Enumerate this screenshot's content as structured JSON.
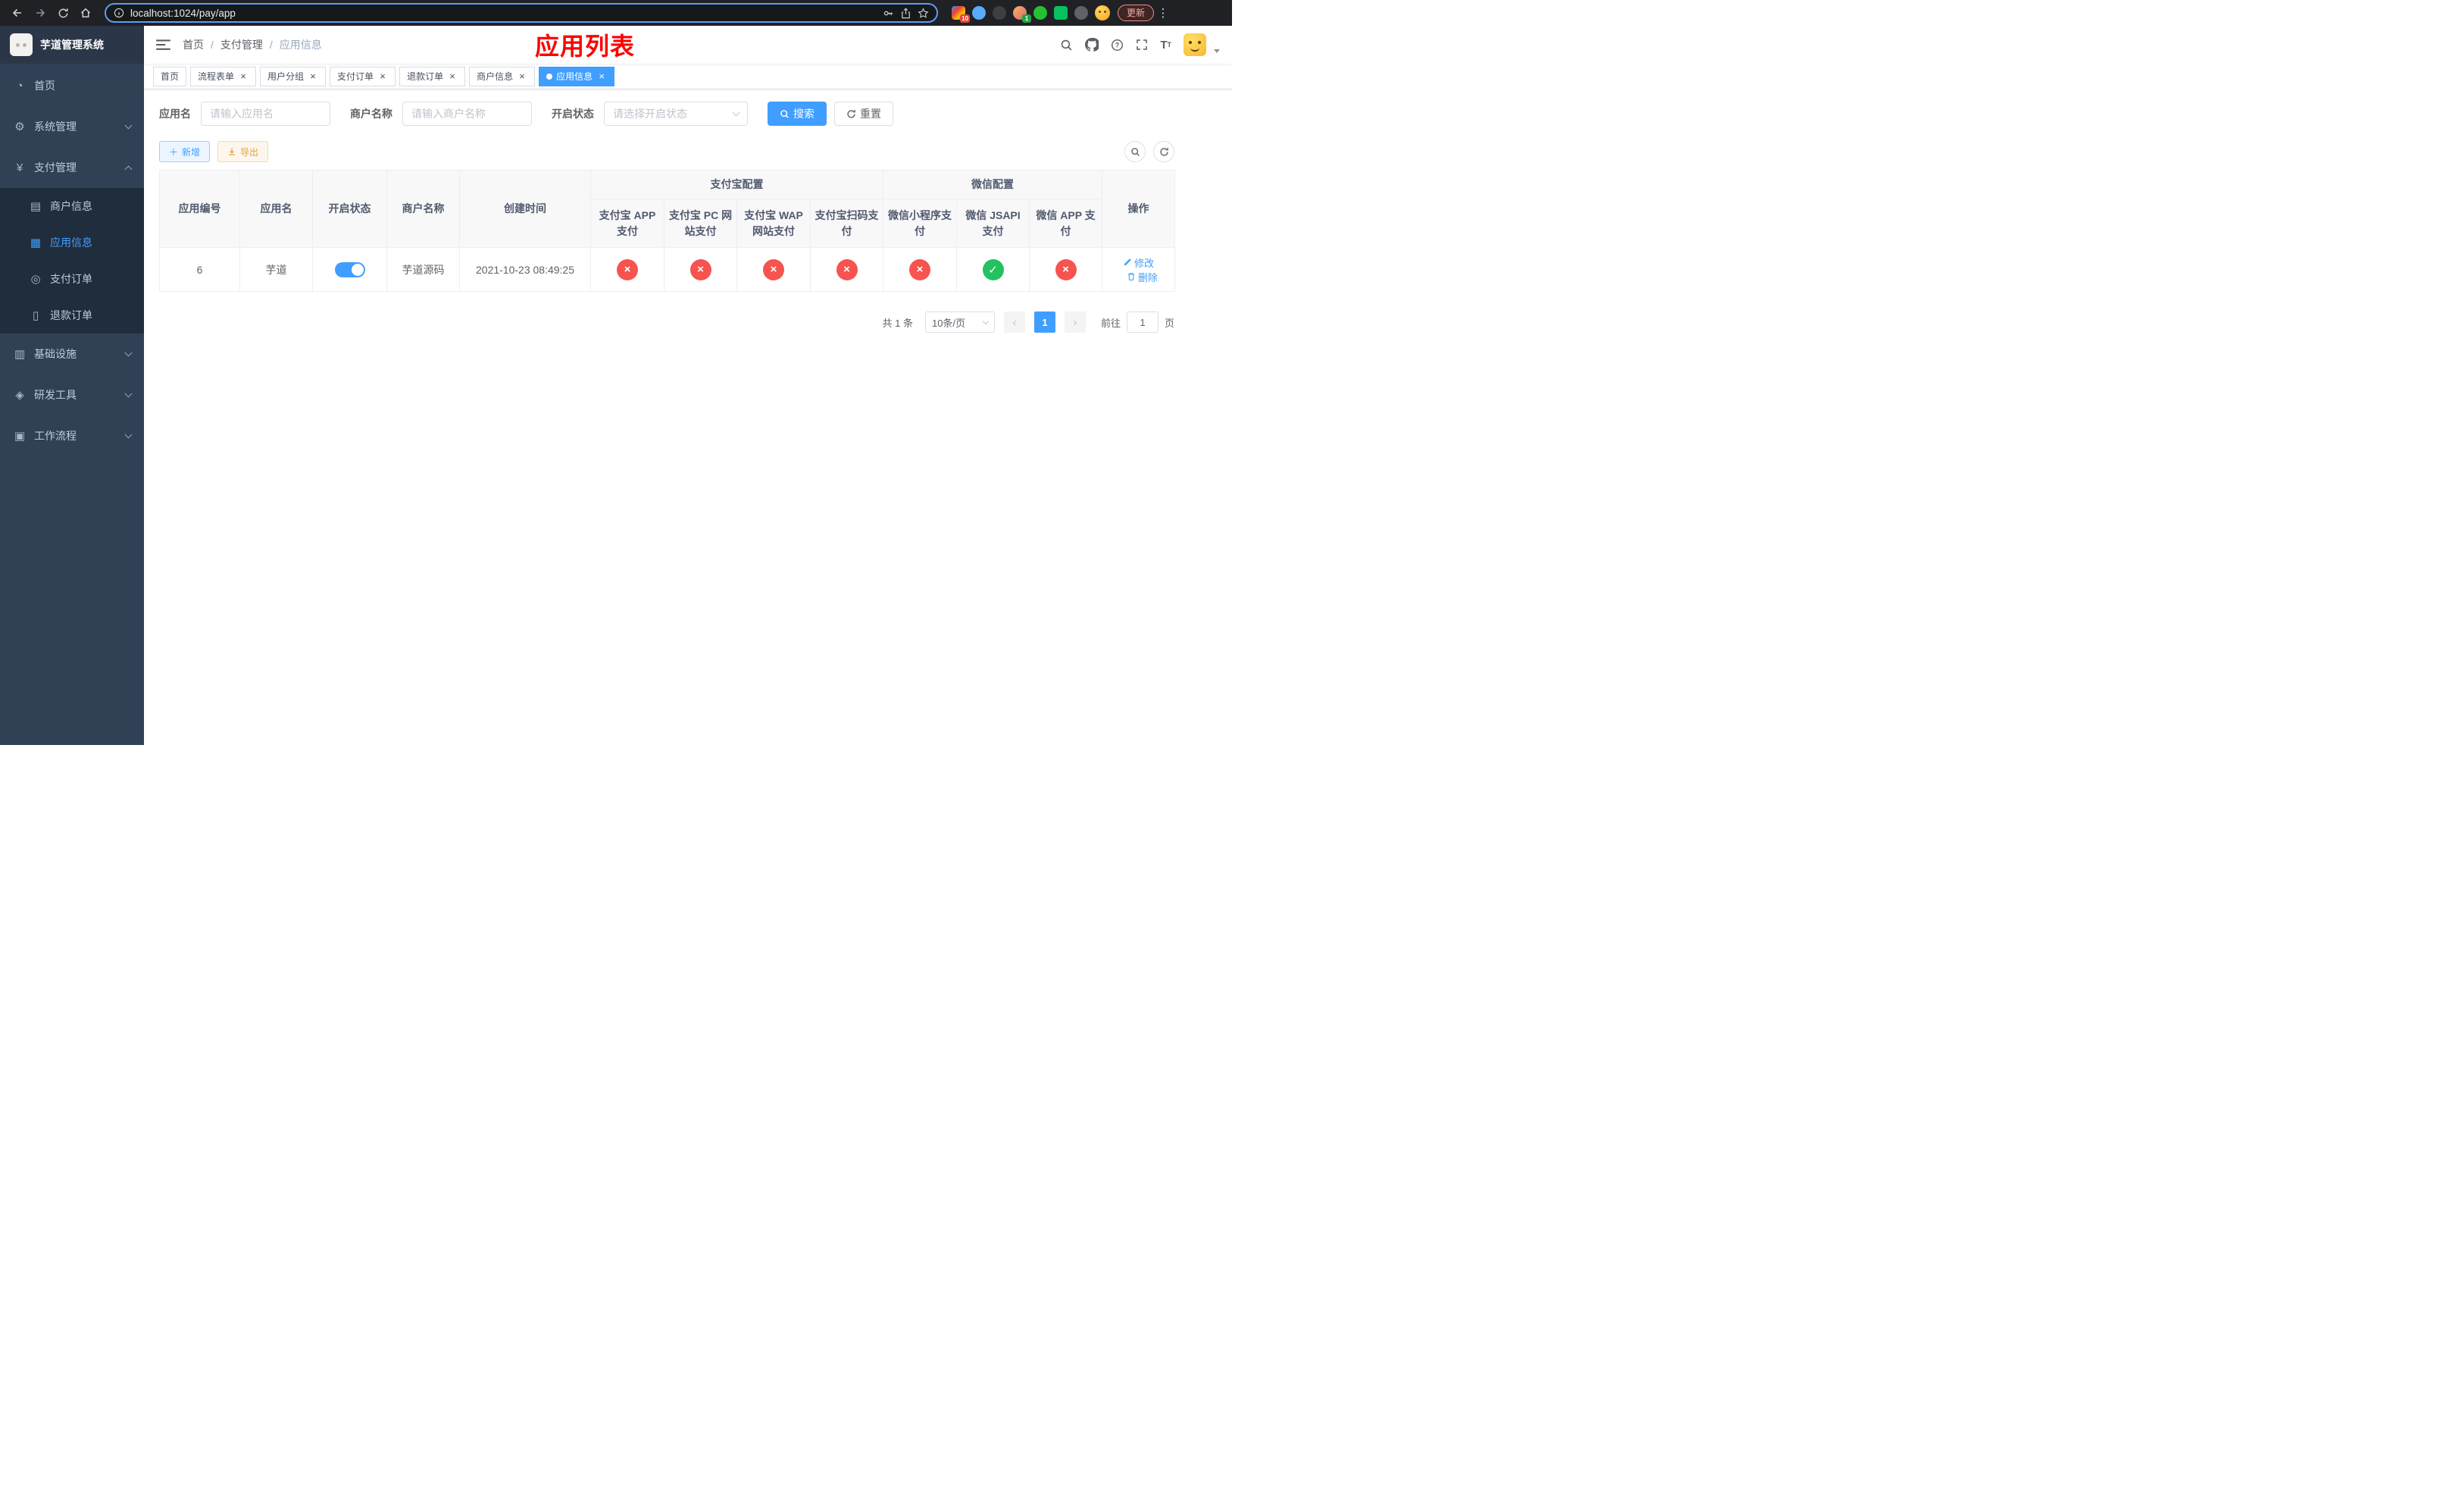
{
  "colors": {
    "accent": "#409eff",
    "success": "#23c160",
    "danger": "#f7534f",
    "warning": "#e6a23c",
    "annotation_red": "#fe0000",
    "sidebar_bg": "#304156",
    "submenu_bg": "#1f2d3d"
  },
  "browser": {
    "url": "localhost:1024/pay/app",
    "update_label": "更新",
    "ext_badge_a": "10",
    "ext_badge_b": "1"
  },
  "sidebar": {
    "title": "芋道管理系统",
    "items": [
      {
        "label": "首页"
      },
      {
        "label": "系统管理"
      },
      {
        "label": "支付管理"
      },
      {
        "label": "基础设施"
      },
      {
        "label": "研发工具"
      },
      {
        "label": "工作流程"
      }
    ],
    "payment_children": [
      {
        "label": "商户信息"
      },
      {
        "label": "应用信息"
      },
      {
        "label": "支付订单"
      },
      {
        "label": "退款订单"
      }
    ]
  },
  "header": {
    "breadcrumb": [
      {
        "label": "首页"
      },
      {
        "label": "支付管理"
      },
      {
        "label": "应用信息"
      }
    ],
    "annotation": "应用列表"
  },
  "tabs": [
    {
      "label": "首页"
    },
    {
      "label": "流程表单"
    },
    {
      "label": "用户分组"
    },
    {
      "label": "支付订单"
    },
    {
      "label": "退款订单"
    },
    {
      "label": "商户信息"
    },
    {
      "label": "应用信息"
    }
  ],
  "filters": {
    "app_name_label": "应用名",
    "app_name_placeholder": "请输入应用名",
    "merchant_label": "商户名称",
    "merchant_placeholder": "请输入商户名称",
    "status_label": "开启状态",
    "status_placeholder": "请选择开启状态",
    "search_label": "搜索",
    "reset_label": "重置"
  },
  "toolbar": {
    "add_label": "新增",
    "export_label": "导出"
  },
  "table": {
    "groups": {
      "alipay": "支付宝配置",
      "wechat": "微信配置"
    },
    "columns": {
      "id": "应用编号",
      "name": "应用名",
      "status": "开启状态",
      "merchant": "商户名称",
      "created": "创建时间",
      "alipay_app": "支付宝 APP 支付",
      "alipay_pc": "支付宝 PC 网站支付",
      "alipay_wap": "支付宝 WAP 网站支付",
      "alipay_qr": "支付宝扫码支付",
      "wx_mini": "微信小程序支付",
      "wx_jsapi": "微信 JSAPI 支付",
      "wx_app": "微信 APP 支付",
      "actions": "操作"
    },
    "row": {
      "id": "6",
      "name": "芋道",
      "status_on": true,
      "merchant": "芋道源码",
      "created": "2021-10-23 08:49:25",
      "configs": [
        false,
        false,
        false,
        false,
        false,
        true,
        false
      ],
      "edit_label": "修改",
      "delete_label": "删除"
    }
  },
  "pagination": {
    "total": "共 1 条",
    "page_size": "10条/页",
    "current_page": "1",
    "goto_label": "前往",
    "goto_value": "1",
    "goto_suffix": "页"
  }
}
